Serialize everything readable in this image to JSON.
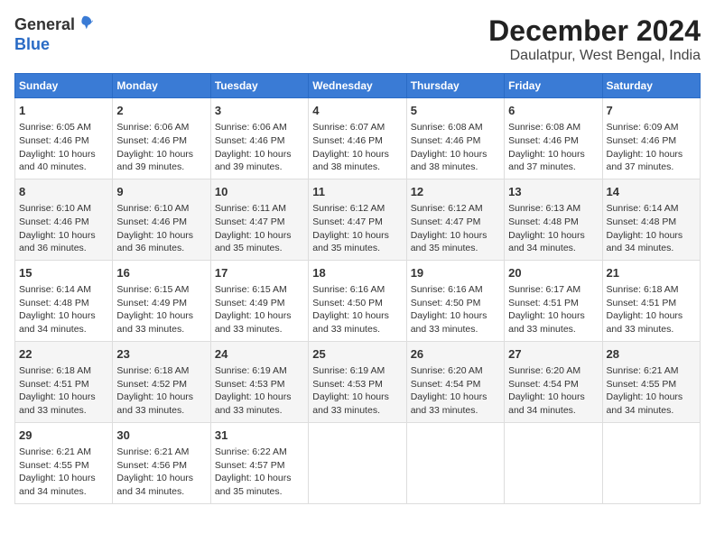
{
  "header": {
    "logo_general": "General",
    "logo_blue": "Blue",
    "month": "December 2024",
    "location": "Daulatpur, West Bengal, India"
  },
  "days_of_week": [
    "Sunday",
    "Monday",
    "Tuesday",
    "Wednesday",
    "Thursday",
    "Friday",
    "Saturday"
  ],
  "weeks": [
    [
      {
        "day": "1",
        "sunrise": "Sunrise: 6:05 AM",
        "sunset": "Sunset: 4:46 PM",
        "daylight": "Daylight: 10 hours and 40 minutes."
      },
      {
        "day": "2",
        "sunrise": "Sunrise: 6:06 AM",
        "sunset": "Sunset: 4:46 PM",
        "daylight": "Daylight: 10 hours and 39 minutes."
      },
      {
        "day": "3",
        "sunrise": "Sunrise: 6:06 AM",
        "sunset": "Sunset: 4:46 PM",
        "daylight": "Daylight: 10 hours and 39 minutes."
      },
      {
        "day": "4",
        "sunrise": "Sunrise: 6:07 AM",
        "sunset": "Sunset: 4:46 PM",
        "daylight": "Daylight: 10 hours and 38 minutes."
      },
      {
        "day": "5",
        "sunrise": "Sunrise: 6:08 AM",
        "sunset": "Sunset: 4:46 PM",
        "daylight": "Daylight: 10 hours and 38 minutes."
      },
      {
        "day": "6",
        "sunrise": "Sunrise: 6:08 AM",
        "sunset": "Sunset: 4:46 PM",
        "daylight": "Daylight: 10 hours and 37 minutes."
      },
      {
        "day": "7",
        "sunrise": "Sunrise: 6:09 AM",
        "sunset": "Sunset: 4:46 PM",
        "daylight": "Daylight: 10 hours and 37 minutes."
      }
    ],
    [
      {
        "day": "8",
        "sunrise": "Sunrise: 6:10 AM",
        "sunset": "Sunset: 4:46 PM",
        "daylight": "Daylight: 10 hours and 36 minutes."
      },
      {
        "day": "9",
        "sunrise": "Sunrise: 6:10 AM",
        "sunset": "Sunset: 4:46 PM",
        "daylight": "Daylight: 10 hours and 36 minutes."
      },
      {
        "day": "10",
        "sunrise": "Sunrise: 6:11 AM",
        "sunset": "Sunset: 4:47 PM",
        "daylight": "Daylight: 10 hours and 35 minutes."
      },
      {
        "day": "11",
        "sunrise": "Sunrise: 6:12 AM",
        "sunset": "Sunset: 4:47 PM",
        "daylight": "Daylight: 10 hours and 35 minutes."
      },
      {
        "day": "12",
        "sunrise": "Sunrise: 6:12 AM",
        "sunset": "Sunset: 4:47 PM",
        "daylight": "Daylight: 10 hours and 35 minutes."
      },
      {
        "day": "13",
        "sunrise": "Sunrise: 6:13 AM",
        "sunset": "Sunset: 4:48 PM",
        "daylight": "Daylight: 10 hours and 34 minutes."
      },
      {
        "day": "14",
        "sunrise": "Sunrise: 6:14 AM",
        "sunset": "Sunset: 4:48 PM",
        "daylight": "Daylight: 10 hours and 34 minutes."
      }
    ],
    [
      {
        "day": "15",
        "sunrise": "Sunrise: 6:14 AM",
        "sunset": "Sunset: 4:48 PM",
        "daylight": "Daylight: 10 hours and 34 minutes."
      },
      {
        "day": "16",
        "sunrise": "Sunrise: 6:15 AM",
        "sunset": "Sunset: 4:49 PM",
        "daylight": "Daylight: 10 hours and 33 minutes."
      },
      {
        "day": "17",
        "sunrise": "Sunrise: 6:15 AM",
        "sunset": "Sunset: 4:49 PM",
        "daylight": "Daylight: 10 hours and 33 minutes."
      },
      {
        "day": "18",
        "sunrise": "Sunrise: 6:16 AM",
        "sunset": "Sunset: 4:50 PM",
        "daylight": "Daylight: 10 hours and 33 minutes."
      },
      {
        "day": "19",
        "sunrise": "Sunrise: 6:16 AM",
        "sunset": "Sunset: 4:50 PM",
        "daylight": "Daylight: 10 hours and 33 minutes."
      },
      {
        "day": "20",
        "sunrise": "Sunrise: 6:17 AM",
        "sunset": "Sunset: 4:51 PM",
        "daylight": "Daylight: 10 hours and 33 minutes."
      },
      {
        "day": "21",
        "sunrise": "Sunrise: 6:18 AM",
        "sunset": "Sunset: 4:51 PM",
        "daylight": "Daylight: 10 hours and 33 minutes."
      }
    ],
    [
      {
        "day": "22",
        "sunrise": "Sunrise: 6:18 AM",
        "sunset": "Sunset: 4:51 PM",
        "daylight": "Daylight: 10 hours and 33 minutes."
      },
      {
        "day": "23",
        "sunrise": "Sunrise: 6:18 AM",
        "sunset": "Sunset: 4:52 PM",
        "daylight": "Daylight: 10 hours and 33 minutes."
      },
      {
        "day": "24",
        "sunrise": "Sunrise: 6:19 AM",
        "sunset": "Sunset: 4:53 PM",
        "daylight": "Daylight: 10 hours and 33 minutes."
      },
      {
        "day": "25",
        "sunrise": "Sunrise: 6:19 AM",
        "sunset": "Sunset: 4:53 PM",
        "daylight": "Daylight: 10 hours and 33 minutes."
      },
      {
        "day": "26",
        "sunrise": "Sunrise: 6:20 AM",
        "sunset": "Sunset: 4:54 PM",
        "daylight": "Daylight: 10 hours and 33 minutes."
      },
      {
        "day": "27",
        "sunrise": "Sunrise: 6:20 AM",
        "sunset": "Sunset: 4:54 PM",
        "daylight": "Daylight: 10 hours and 34 minutes."
      },
      {
        "day": "28",
        "sunrise": "Sunrise: 6:21 AM",
        "sunset": "Sunset: 4:55 PM",
        "daylight": "Daylight: 10 hours and 34 minutes."
      }
    ],
    [
      {
        "day": "29",
        "sunrise": "Sunrise: 6:21 AM",
        "sunset": "Sunset: 4:55 PM",
        "daylight": "Daylight: 10 hours and 34 minutes."
      },
      {
        "day": "30",
        "sunrise": "Sunrise: 6:21 AM",
        "sunset": "Sunset: 4:56 PM",
        "daylight": "Daylight: 10 hours and 34 minutes."
      },
      {
        "day": "31",
        "sunrise": "Sunrise: 6:22 AM",
        "sunset": "Sunset: 4:57 PM",
        "daylight": "Daylight: 10 hours and 35 minutes."
      },
      null,
      null,
      null,
      null
    ]
  ]
}
